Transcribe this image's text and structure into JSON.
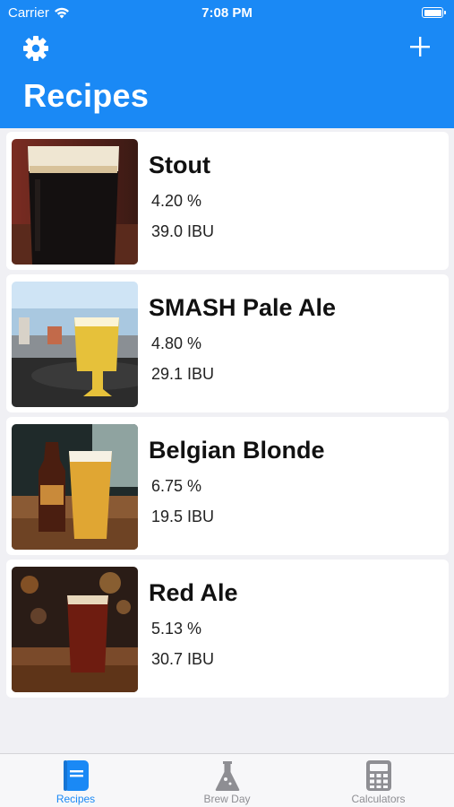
{
  "status_bar": {
    "carrier": "Carrier",
    "time": "7:08 PM"
  },
  "header": {
    "title": "Recipes",
    "left_icon": "gear-icon",
    "right_icon": "plus-icon",
    "background_color": "#1a89f5"
  },
  "recipes": [
    {
      "name": "Stout",
      "abv": "4.20 %",
      "ibu": "39.0 IBU",
      "image": "stout-beer-photo"
    },
    {
      "name": "SMASH Pale Ale",
      "abv": "4.80 %",
      "ibu": "29.1 IBU",
      "image": "pale-ale-photo"
    },
    {
      "name": "Belgian Blonde",
      "abv": "6.75 %",
      "ibu": "19.5 IBU",
      "image": "blonde-ale-photo"
    },
    {
      "name": "Red Ale",
      "abv": "5.13 %",
      "ibu": "30.7 IBU",
      "image": "red-ale-photo"
    }
  ],
  "tabbar": {
    "tabs": [
      {
        "label": "Recipes",
        "icon": "book-icon",
        "active": true
      },
      {
        "label": "Brew Day",
        "icon": "flask-icon",
        "active": false
      },
      {
        "label": "Calculators",
        "icon": "calculator-icon",
        "active": false
      }
    ],
    "active_color": "#1a89f5",
    "inactive_color": "#8e8e93"
  }
}
